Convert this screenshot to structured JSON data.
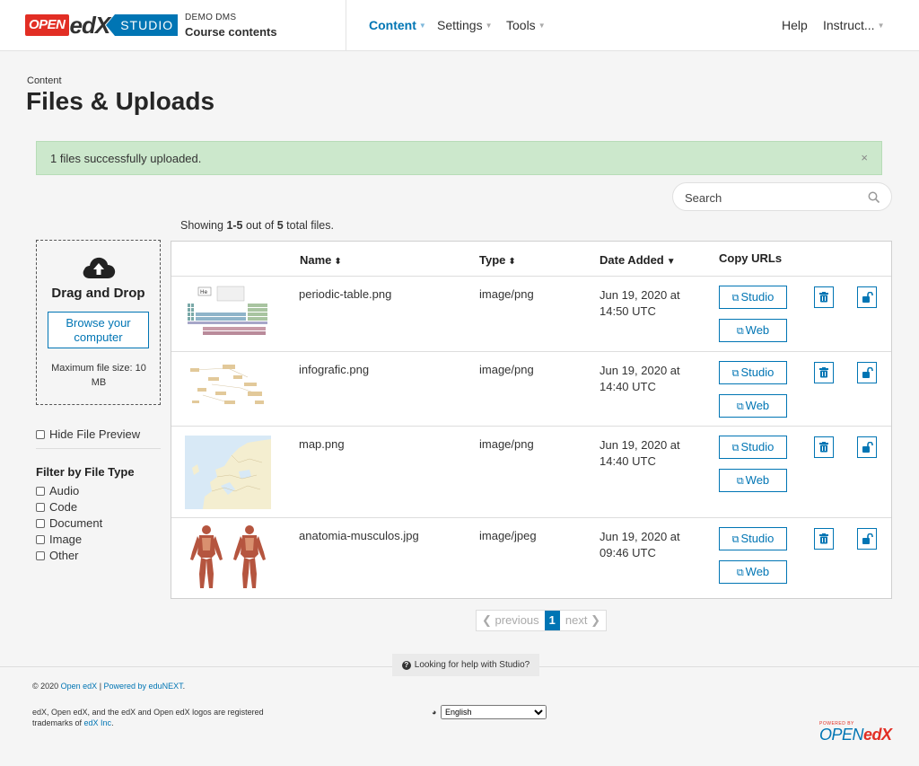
{
  "header": {
    "logo_open": "OPEN",
    "logo_edx": "edX",
    "logo_studio": "STUDIO",
    "course_org": "DEMO DMS",
    "course_title": "Course contents",
    "nav": {
      "content": "Content",
      "settings": "Settings",
      "tools": "Tools",
      "help": "Help",
      "user": "Instruct..."
    }
  },
  "page": {
    "breadcrumb": "Content",
    "title": "Files & Uploads"
  },
  "alert": {
    "message": "1 files successfully uploaded.",
    "close": "×"
  },
  "search": {
    "placeholder": "Search"
  },
  "summary": {
    "prefix": "Showing ",
    "range": "1-5",
    "middle": " out of ",
    "total": "5",
    "suffix": " total files."
  },
  "dropzone": {
    "title": "Drag and Drop",
    "browse": "Browse your computer",
    "max_size": "Maximum file size: 10 MB"
  },
  "sidebar": {
    "hide_preview": "Hide File Preview",
    "filter_title": "Filter by File Type",
    "filters": [
      "Audio",
      "Code",
      "Document",
      "Image",
      "Other"
    ]
  },
  "table": {
    "headers": {
      "name": "Name",
      "type": "Type",
      "date": "Date Added",
      "copy": "Copy URLs"
    },
    "studio_label": "Studio",
    "web_label": "Web",
    "rows": [
      {
        "name": "periodic-table.png",
        "type": "image/png",
        "date_line1": "Jun 19, 2020 at",
        "date_line2": "14:50 UTC"
      },
      {
        "name": "infografic.png",
        "type": "image/png",
        "date_line1": "Jun 19, 2020 at",
        "date_line2": "14:40 UTC"
      },
      {
        "name": "map.png",
        "type": "image/png",
        "date_line1": "Jun 19, 2020 at",
        "date_line2": "14:40 UTC"
      },
      {
        "name": "anatomia-musculos.jpg",
        "type": "image/jpeg",
        "date_line1": "Jun 19, 2020 at",
        "date_line2": "09:46 UTC"
      }
    ]
  },
  "pagination": {
    "previous": "previous",
    "current": "1",
    "next": "next"
  },
  "footer": {
    "help": "Looking for help with Studio?",
    "copyright_prefix": "© 2020 ",
    "copyright_link": "Open edX",
    "separator": " | ",
    "powered_link": "Powered by eduNEXT",
    "copyright_suffix": ".",
    "trademarks_text": "edX, Open edX, and the edX and Open edX logos are registered trademarks of ",
    "trademarks_link": "edX Inc",
    "trademarks_suffix": ".",
    "language": "English",
    "powered_small": "POWERED BY",
    "powered_open": "OPEN",
    "powered_edx": "edX"
  },
  "colors": {
    "accent": "#0075b4",
    "brand_red": "#e22e24",
    "success_bg": "#cce8cc"
  }
}
